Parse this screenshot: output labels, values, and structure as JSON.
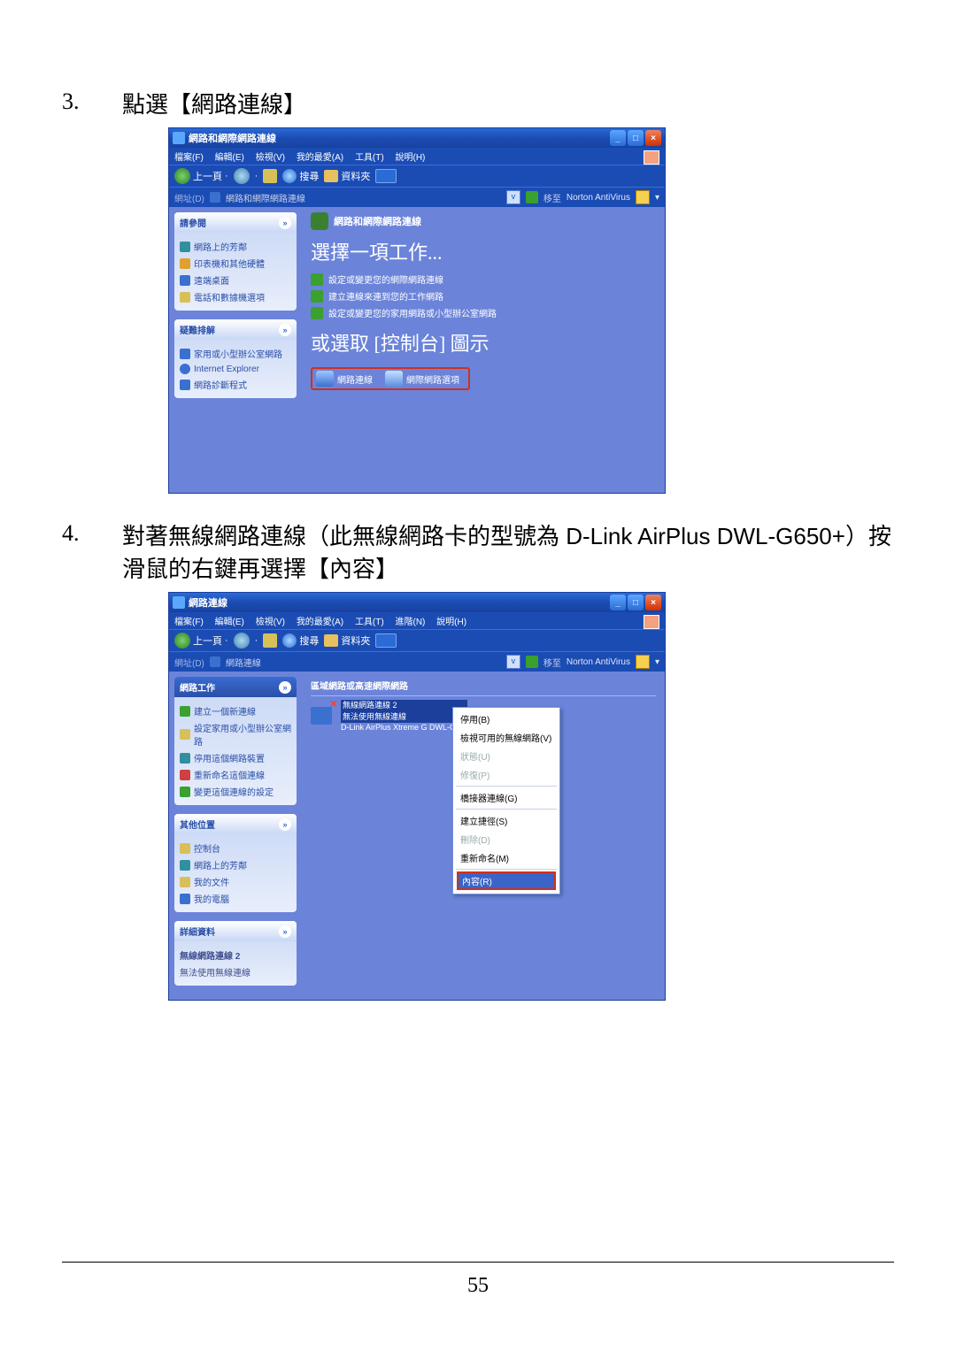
{
  "step3": {
    "num": "3.",
    "text": "點選【網路連線】"
  },
  "step4": {
    "num": "4.",
    "text": "對著無線網路連線（此無線網路卡的型號為 D-Link AirPlus DWL-G650+）按滑鼠的右鍵再選擇【內容】"
  },
  "page_number": "55",
  "win1": {
    "title": "網路和網際網路連線",
    "menu": [
      "檔案(F)",
      "編輯(E)",
      "檢視(V)",
      "我的最愛(A)",
      "工具(T)",
      "說明(H)"
    ],
    "toolbar": {
      "back": "上一頁",
      "search": "搜尋",
      "folders": "資料夾"
    },
    "address": {
      "label": "網址(D)",
      "path": "網路和網際網路連線",
      "go": "移至",
      "norton": "Norton AntiVirus"
    },
    "sidebar": {
      "panel1": {
        "title": "請參閱",
        "items": [
          "網路上的芳鄰",
          "印表機和其他硬體",
          "遠端桌面",
          "電話和數據機選項"
        ]
      },
      "panel2": {
        "title": "疑難排解",
        "items": [
          "家用或小型辦公室網路",
          "Internet Explorer",
          "網路診斷程式"
        ]
      }
    },
    "content": {
      "header": "網路和網際網路連線",
      "heading1": "選擇一項工作...",
      "tasks1": [
        "設定或變更您的網際網路連線",
        "建立連線來連到您的工作網路",
        "設定或變更您的家用網路或小型辦公室網路"
      ],
      "heading2": "或選取 [控制台] 圖示",
      "highlight": [
        "網路連線",
        "網際網路選項"
      ]
    }
  },
  "win2": {
    "title": "網路連線",
    "menu": [
      "檔案(F)",
      "編輯(E)",
      "檢視(V)",
      "我的最愛(A)",
      "工具(T)",
      "進階(N)",
      "說明(H)"
    ],
    "toolbar": {
      "back": "上一頁",
      "search": "搜尋",
      "folders": "資料夾"
    },
    "address": {
      "label": "網址(D)",
      "path": "網路連線",
      "go": "移至",
      "norton": "Norton AntiVirus"
    },
    "sidebar": {
      "panel1": {
        "title": "網路工作",
        "items": [
          "建立一個新連線",
          "設定家用或小型辦公室網路",
          "停用這個網路裝置",
          "重新命名這個連線",
          "變更這個連線的設定"
        ]
      },
      "panel2": {
        "title": "其他位置",
        "items": [
          "控制台",
          "網路上的芳鄰",
          "我的文件",
          "我的電腦"
        ]
      },
      "panel3": {
        "title": "詳細資料",
        "details": [
          "無線網路連線 2",
          "無法使用無線連線"
        ]
      }
    },
    "content": {
      "lan_header": "區域網路或高速網際網路",
      "conn": {
        "line1": "無線網路連線 2",
        "line2": "無法使用無線連線",
        "line3": "D-Link AirPlus Xtreme G DWL-G6..."
      }
    },
    "ctx": {
      "items": [
        {
          "label": "停用(B)",
          "disabled": false
        },
        {
          "label": "檢視可用的無線網路(V)",
          "disabled": false
        },
        {
          "label": "狀態(U)",
          "disabled": true
        },
        {
          "label": "修復(P)",
          "disabled": true
        },
        {
          "sep": true
        },
        {
          "label": "橋接器連線(G)",
          "disabled": false
        },
        {
          "sep": true
        },
        {
          "label": "建立捷徑(S)",
          "disabled": false
        },
        {
          "label": "刪除(D)",
          "disabled": true
        },
        {
          "label": "重新命名(M)",
          "disabled": false
        },
        {
          "sep": true
        },
        {
          "label": "內容(R)",
          "highlight": true
        }
      ]
    }
  }
}
